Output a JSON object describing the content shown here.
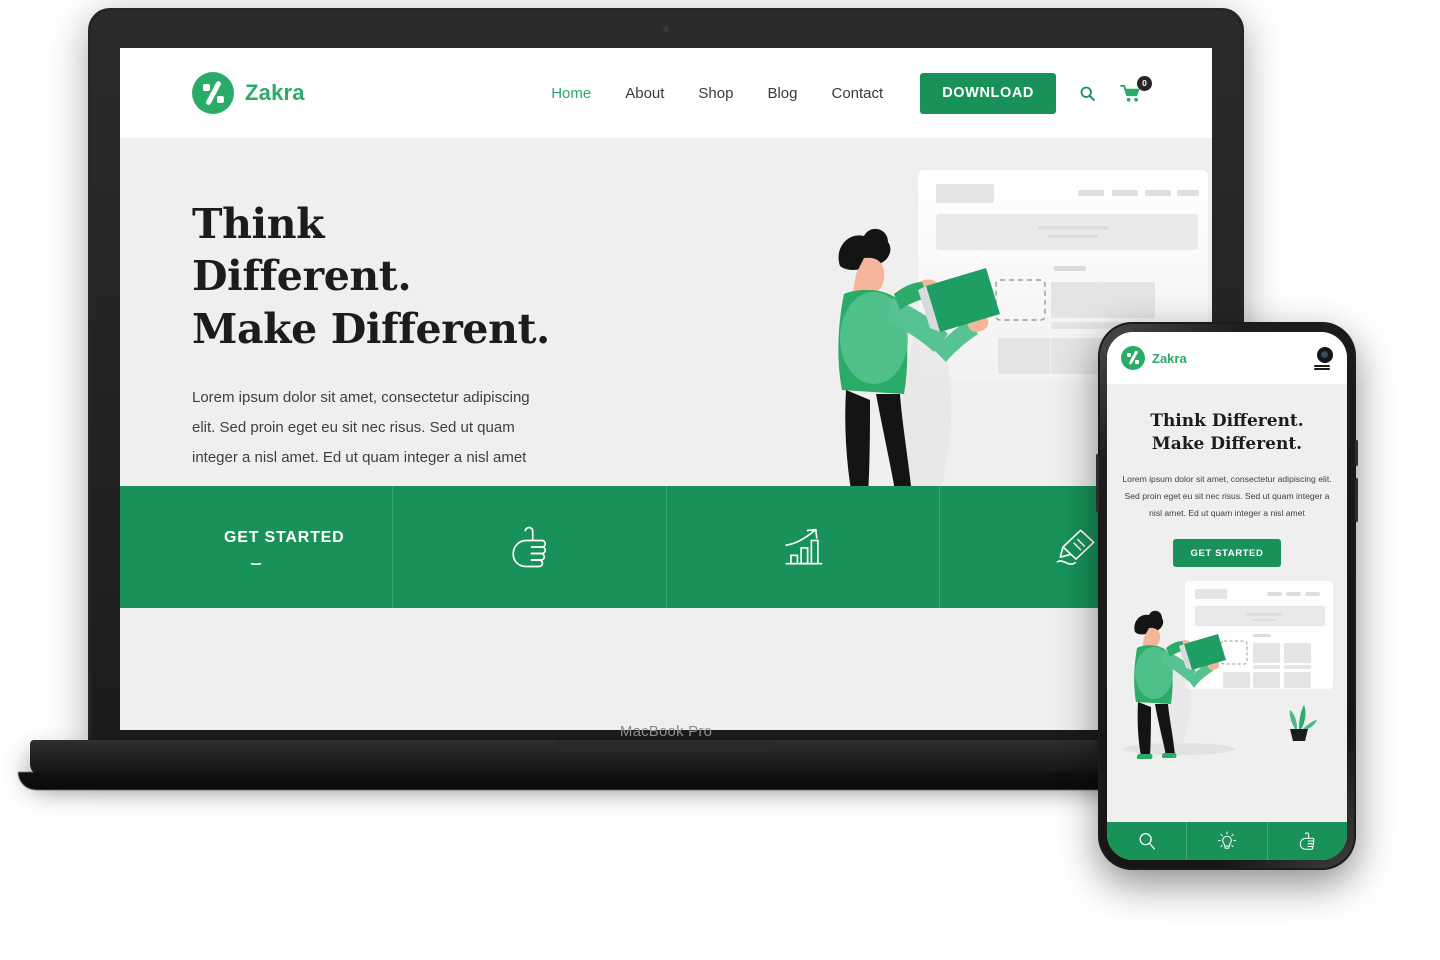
{
  "device_laptop": {
    "brand_label": "MacBook Pro",
    "webcam": "webcam-dot"
  },
  "site": {
    "brand": {
      "name": "Zakra",
      "logo_icon": "zakra-logo-icon",
      "color": "#2bab68"
    },
    "nav": {
      "items": [
        {
          "label": "Home",
          "active": true
        },
        {
          "label": "About",
          "active": false
        },
        {
          "label": "Shop",
          "active": false
        },
        {
          "label": "Blog",
          "active": false
        },
        {
          "label": "Contact",
          "active": false
        }
      ],
      "download_label": "DOWNLOAD",
      "search_icon": "search-icon",
      "cart_icon": "cart-icon",
      "cart_count": "0"
    },
    "hero": {
      "title_line1": "Think Different.",
      "title_line2": "Make Different.",
      "paragraph": "Lorem ipsum dolor sit amet, consectetur adipiscing elit. Sed proin eget eu sit nec risus. Sed ut quam integer a nisl amet.  Ed ut quam integer a nisl amet",
      "cta_label": "GET STARTED",
      "illustration": "person-placing-block-on-wireframe"
    },
    "features": [
      {
        "icon": "lightbulb-icon"
      },
      {
        "icon": "thumbs-up-icon"
      },
      {
        "icon": "growth-chart-icon"
      },
      {
        "icon": "highlighter-pen-icon"
      }
    ]
  },
  "phone": {
    "brand": {
      "name": "Zakra",
      "logo_icon": "zakra-logo-icon"
    },
    "menu_icon": "hamburger-menu-icon",
    "camera_icon": "front-camera-icon",
    "hero": {
      "title_line1": "Think Different.",
      "title_line2": "Make Different.",
      "paragraph": "Lorem ipsum dolor sit amet, consectetur adipiscing elit. Sed proin eget eu sit nec risus. Sed ut quam integer a nisl amet.  Ed ut quam integer a nisl amet",
      "cta_label": "GET STARTED",
      "illustration": "person-placing-block-on-wireframe"
    },
    "tabbar": [
      {
        "icon": "search-icon"
      },
      {
        "icon": "lightbulb-icon"
      },
      {
        "icon": "thumbs-up-icon"
      }
    ]
  },
  "theme": {
    "green": "#189259",
    "green_light": "#2bab68",
    "hero_bg": "#efefef",
    "header_bg": "#ffffff",
    "text_dark": "#1c1c1c"
  }
}
